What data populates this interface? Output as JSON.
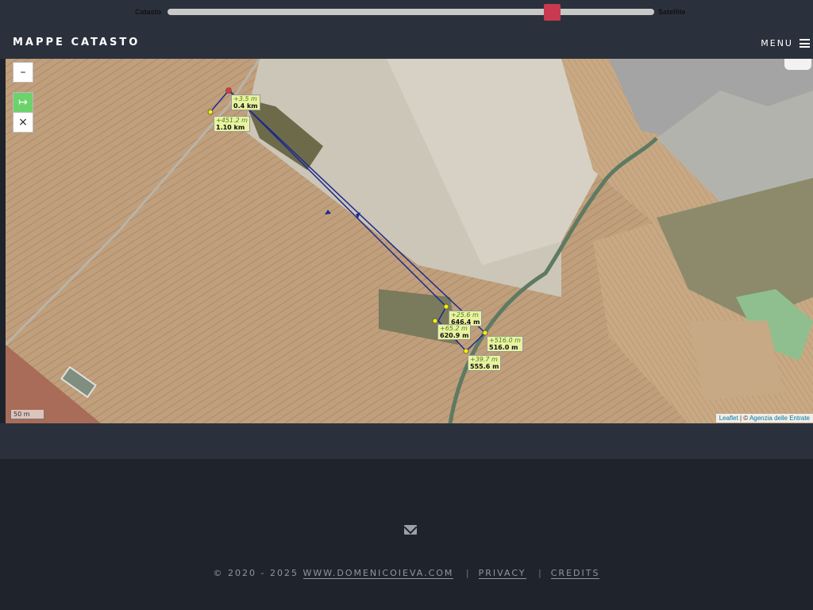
{
  "slider": {
    "left_label": "Catasto",
    "right_label": "Satellite",
    "value_percent": 78
  },
  "header": {
    "brand": "MAPPE CATASTO",
    "menu_label": "MENU"
  },
  "map_controls": {
    "zoom_out": "–",
    "measure": "↦",
    "clear": "×"
  },
  "measurements": [
    {
      "delta": "+3.5 m",
      "total": "0.4 km"
    },
    {
      "delta": "+451.2 m",
      "total": "1.10 km"
    },
    {
      "delta": "+25.6 m",
      "total": "646.4 m"
    },
    {
      "delta": "+65.2 m",
      "total": "620.9 m"
    },
    {
      "delta": "+516.0 m",
      "total": "516.0 m"
    },
    {
      "delta": "+39.7 m",
      "total": "555.6 m"
    }
  ],
  "scale": "50 m",
  "attribution": {
    "leaflet": "Leaflet",
    "separator": " | © ",
    "source": "Agenzia delle Entrate"
  },
  "footer": {
    "copyright": "© 2020 - 2025",
    "site": "WWW.DOMENICOIEVA.COM",
    "privacy": "PRIVACY",
    "credits": "CREDITS",
    "separator": "|"
  },
  "colors": {
    "accent": "#c9394f",
    "measure_line": "#1c2a8c",
    "header_bg": "#2b313c",
    "footer_bg": "#1f242c"
  }
}
